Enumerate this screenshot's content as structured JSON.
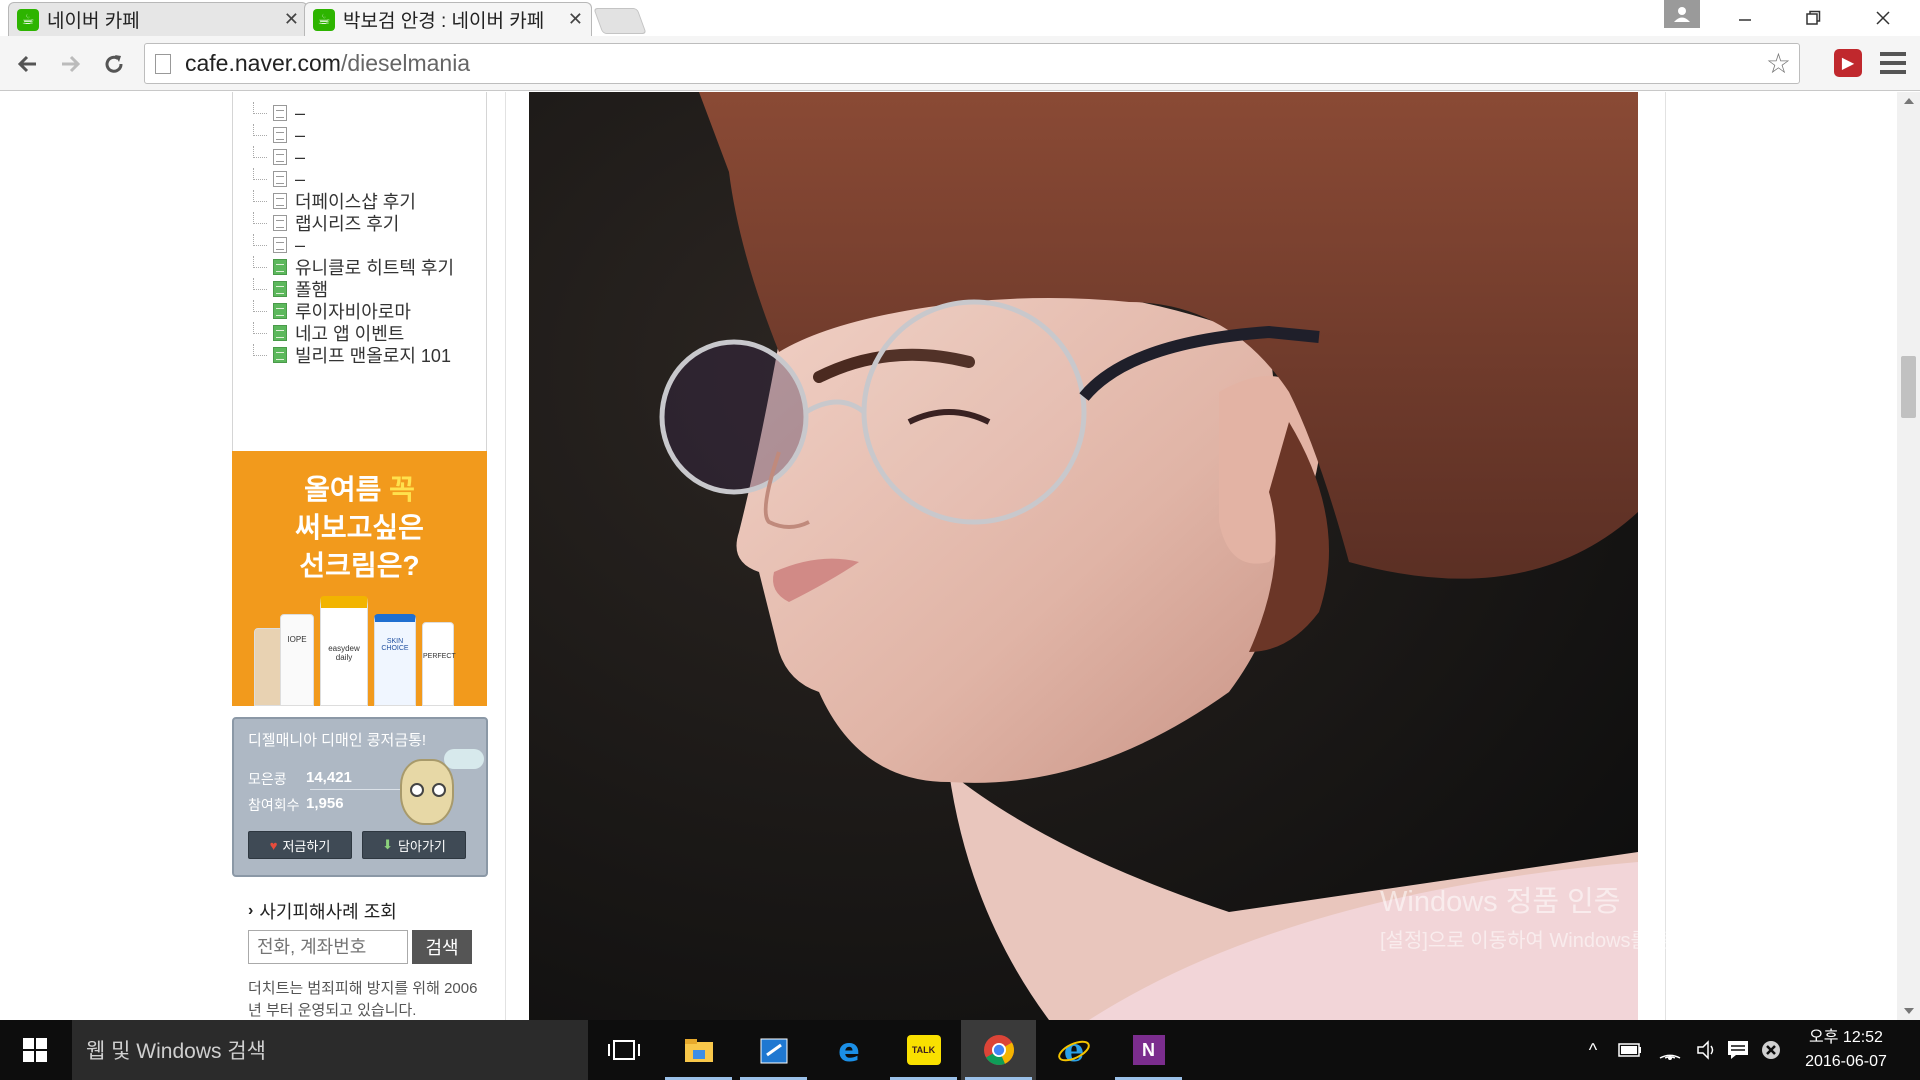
{
  "browser": {
    "tabs": [
      {
        "title": "네이버 카페",
        "favicon": "naver-cafe-icon",
        "active": false
      },
      {
        "title": "박보검 안경 : 네이버 카페",
        "favicon": "naver-cafe-icon",
        "active": true
      }
    ],
    "url_host": "cafe.naver.com",
    "url_path": "/dieselmania"
  },
  "sidebar": {
    "menu_items": [
      {
        "label": "–",
        "icon": "doc-icon"
      },
      {
        "label": "–",
        "icon": "doc-icon"
      },
      {
        "label": "–",
        "icon": "doc-icon"
      },
      {
        "label": "–",
        "icon": "doc-icon"
      },
      {
        "label": "더페이스샵 후기",
        "icon": "doc-icon"
      },
      {
        "label": "랩시리즈 후기",
        "icon": "doc-icon"
      },
      {
        "label": "–",
        "icon": "doc-icon"
      },
      {
        "label": "유니클로 히트텍 후기",
        "icon": "green-doc-icon"
      },
      {
        "label": "폴햄",
        "icon": "green-doc-icon"
      },
      {
        "label": "루이자비아로마",
        "icon": "green-doc-icon"
      },
      {
        "label": "네고 앱 이벤트",
        "icon": "green-doc-icon"
      },
      {
        "label": "빌리프 맨올로지 101",
        "icon": "green-doc-icon"
      }
    ],
    "ad": {
      "line1": "올여름",
      "line1_highlight": "꼭",
      "line2": "써보고싶은",
      "line3": "선크림은?",
      "products": [
        "IOPE",
        "easydew daily",
        "SKIN CHOICE",
        "PERFECT"
      ]
    },
    "coin": {
      "title": "디젤매니아 디매인 콩저금통!",
      "collected_label": "모은콩",
      "collected_value": "14,421",
      "participants_label": "참여회수",
      "participants_value": "1,956",
      "save_button": "저금하기",
      "take_button": "담아가기"
    },
    "fraud": {
      "title": "사기피해사례 조회",
      "placeholder": "전화, 계좌번호",
      "search_button": "검색",
      "description": "더치트는 범죄피해 방지를 위해 2006년 부터 운영되고 있습니다."
    }
  },
  "watermark": {
    "title": "Windows 정품 인증",
    "subtitle": "[설정]으로 이동하여 Windows를 정품 인증합니다."
  },
  "taskbar": {
    "search_text": "웹 및 Windows 검색",
    "apps": [
      "task-view-icon",
      "file-explorer-icon",
      "store-icon",
      "edge-icon",
      "kakaotalk-icon",
      "chrome-icon",
      "internet-explorer-icon",
      "onenote-icon"
    ],
    "kakao_label": "TALK",
    "onenote_label": "N",
    "clock_time": "오후 12:52",
    "clock_date": "2016-06-07"
  },
  "colors": {
    "naver_green": "#2db400",
    "ad_orange": "#f29a1c",
    "coin_box": "#aeb8c4",
    "taskbar": "#0d0d0d"
  }
}
